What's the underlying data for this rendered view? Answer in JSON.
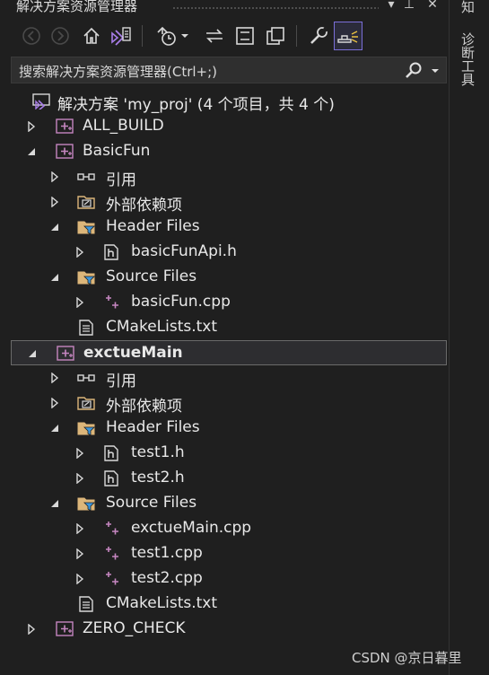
{
  "window": {
    "title": "解决方案资源管理器",
    "buttons": {
      "pin": "⊼",
      "pushpin": "ᵽ",
      "close": "✕"
    }
  },
  "toolbar": {
    "icons": [
      "back-arrow-icon",
      "forward-arrow-icon",
      "home-icon",
      "vs-switch-view-icon",
      "pending-changes-icon",
      "dropdown-arrow-icon",
      "sync-icon",
      "collapse-all-icon",
      "show-all-files-icon",
      "properties-wrench-icon",
      "preview-selected-icon"
    ]
  },
  "search": {
    "placeholder": "搜索解决方案资源管理器(Ctrl+;)"
  },
  "tree": {
    "solution": "解决方案 'my_proj' (4 个项目，共 4 个)",
    "items": [
      {
        "label": "ALL_BUILD",
        "type": "project",
        "level": 0,
        "state": "collapsed"
      },
      {
        "label": "BasicFun",
        "type": "project",
        "level": 0,
        "state": "expanded"
      },
      {
        "label": "引用",
        "type": "references",
        "level": 1,
        "state": "collapsed"
      },
      {
        "label": "外部依赖项",
        "type": "external",
        "level": 1,
        "state": "collapsed"
      },
      {
        "label": "Header Files",
        "type": "filter",
        "level": 1,
        "state": "expanded"
      },
      {
        "label": "basicFunApi.h",
        "type": "header",
        "level": 2,
        "state": "collapsed"
      },
      {
        "label": "Source Files",
        "type": "filter",
        "level": 1,
        "state": "expanded"
      },
      {
        "label": "basicFun.cpp",
        "type": "cpp",
        "level": 2,
        "state": "collapsed"
      },
      {
        "label": "CMakeLists.txt",
        "type": "txt",
        "level": 1,
        "state": "none"
      },
      {
        "label": "exctueMain",
        "type": "project",
        "level": 0,
        "state": "expanded",
        "selected": true
      },
      {
        "label": "引用",
        "type": "references",
        "level": 1,
        "state": "collapsed"
      },
      {
        "label": "外部依赖项",
        "type": "external",
        "level": 1,
        "state": "collapsed"
      },
      {
        "label": "Header Files",
        "type": "filter",
        "level": 1,
        "state": "expanded"
      },
      {
        "label": "test1.h",
        "type": "header",
        "level": 2,
        "state": "collapsed"
      },
      {
        "label": "test2.h",
        "type": "header",
        "level": 2,
        "state": "collapsed"
      },
      {
        "label": "Source Files",
        "type": "filter",
        "level": 1,
        "state": "expanded"
      },
      {
        "label": "exctueMain.cpp",
        "type": "cpp",
        "level": 2,
        "state": "collapsed"
      },
      {
        "label": "test1.cpp",
        "type": "cpp",
        "level": 2,
        "state": "collapsed"
      },
      {
        "label": "test2.cpp",
        "type": "cpp",
        "level": 2,
        "state": "collapsed"
      },
      {
        "label": "CMakeLists.txt",
        "type": "txt",
        "level": 1,
        "state": "none"
      },
      {
        "label": "ZERO_CHECK",
        "type": "project",
        "level": 0,
        "state": "collapsed"
      }
    ]
  },
  "rail": {
    "tabs": [
      "知",
      "诊断工具"
    ]
  },
  "watermark": "CSDN @京日暮里",
  "colors": {
    "background": "#1f1f1f",
    "accent": "#7b6fd8",
    "project_purple": "#c586c0",
    "filter_blue": "#3a96dd",
    "folder_yellow": "#dcb67a"
  }
}
